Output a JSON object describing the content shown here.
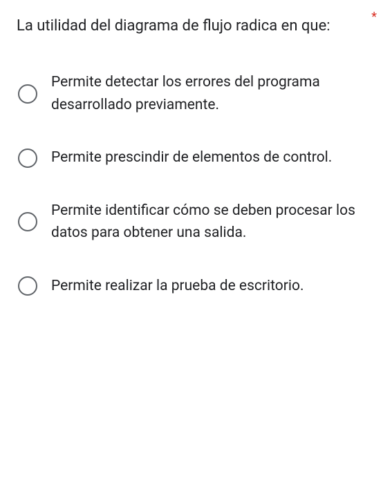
{
  "question": {
    "text": "La utilidad del diagrama de flujo radica en que:",
    "required_marker": "*"
  },
  "options": [
    {
      "label": "Permite detectar los errores del programa desarrollado previamente."
    },
    {
      "label": "Permite prescindir de elementos de control."
    },
    {
      "label": "Permite identificar cómo se deben procesar los datos para obtener una salida."
    },
    {
      "label": "Permite realizar la prueba de escritorio."
    }
  ]
}
